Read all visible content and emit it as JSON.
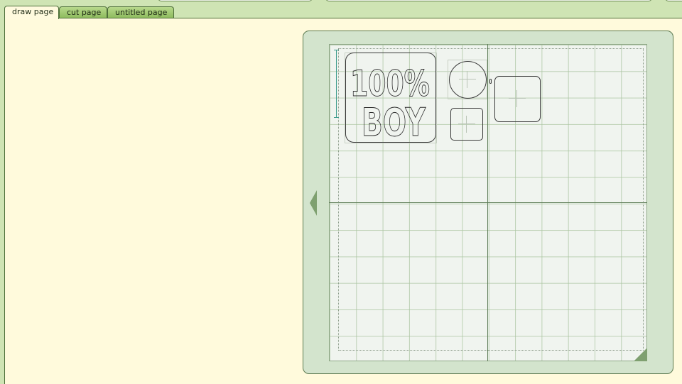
{
  "tabs": [
    {
      "label": "draw page",
      "active": true
    },
    {
      "label": "cut page",
      "active": false
    },
    {
      "label": "untitled page",
      "active": false
    }
  ],
  "artwork": {
    "line1": "100%",
    "line2": "BOY"
  },
  "colors": {
    "workspace": "#fffadc",
    "tab_active": "#fffade",
    "tab_inactive": "#9cc56c",
    "mat_frame": "#d3e4cd",
    "mat": "#f0f4ef",
    "ruler": "#3a9a8a"
  }
}
